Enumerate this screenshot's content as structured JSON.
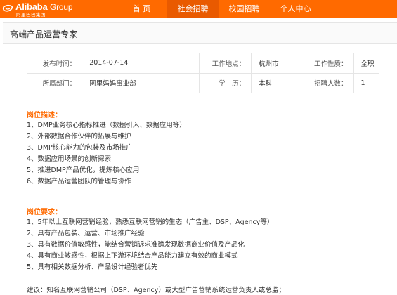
{
  "header": {
    "logo": {
      "en": "Alibaba",
      "group": "Group",
      "cn": "阿里巴巴集团"
    },
    "nav": [
      "首 页",
      "社会招聘",
      "校园招聘",
      "个人中心"
    ],
    "active_index": 1
  },
  "job": {
    "title": "高端产品运营专家",
    "info": {
      "publish_label": "发布时间：",
      "publish_value": "2014-07-14",
      "location_label": "工作地点：",
      "location_value": "杭州市",
      "type_label": "工作性质：",
      "type_value": "全职",
      "dept_label": "所属部门：",
      "dept_value": "阿里妈妈事业部",
      "edu_label": "学　历：",
      "edu_value": "本科",
      "headcount_label": "招聘人数：",
      "headcount_value": "1"
    },
    "description_heading": "岗位描述：",
    "description": [
      "1、DMP业务核心指标推进（数据引入、数据应用等）",
      "2、外部数据合作伙伴的拓展与维护",
      "3、DMP核心能力的包装及市场推广",
      "4、数据应用场景的创新探索",
      "5、推进DMP产品优化，提炼核心应用",
      "6、数据产品运营团队的管理与协作"
    ],
    "requirements_heading": "岗位要求：",
    "requirements": [
      "1、5年以上互联网营销经验，熟悉互联网营销的生态（广告主、DSP、Agency等）",
      "2、具有产品包装、运营、市场推广经验",
      "3、具有数据价值敏感性，能结合营销诉求准确发现数据商业价值及产品化",
      "4、具有商业敏感性，根据上下游环境结合产品能力建立有效的商业模式",
      "5、具有相关数据分析、产品设计经验者优先"
    ],
    "suggestion": "建议：知名互联网营销公司（DSP、Agency）或大型广告营销系统运营负责人或总监；"
  },
  "colors": {
    "brand": "#ff6a00",
    "nav_active": "#e95a00",
    "heading": "#ff6a00"
  }
}
